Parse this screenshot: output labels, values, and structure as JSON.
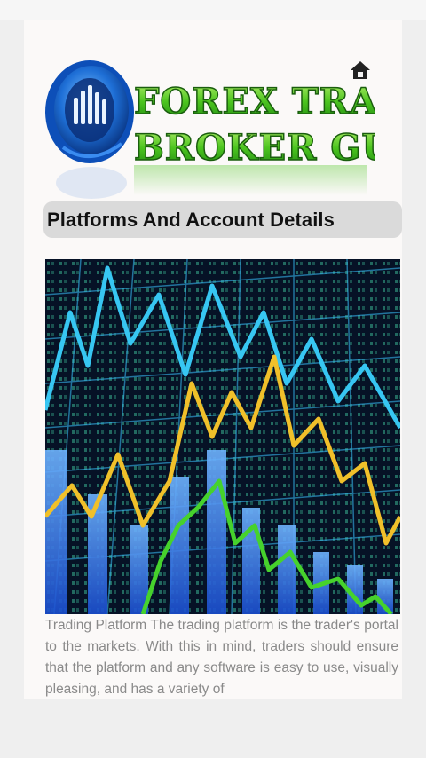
{
  "logo": {
    "line1": "FOREX TRADL",
    "line2": "BROKER GUIDE",
    "alt": "Forex Tradl Broker Guide"
  },
  "icons": {
    "home": "home-icon",
    "logo_mark": "bar-chart-globe-icon"
  },
  "colors": {
    "logo_green": "#5ad62a",
    "logo_blue": "#1e7be0",
    "title_bg": "#dadada",
    "body_text": "#8a8a8a"
  },
  "section": {
    "title": "Platforms And Account Details"
  },
  "hero_image": {
    "description_icon": "trading-chart-image"
  },
  "article": {
    "text": "Trading Platform The trading platform is the trader's portal to the markets. With this in mind, traders should ensure that the platform and any software is easy to use, visually pleasing, and has a variety of"
  }
}
